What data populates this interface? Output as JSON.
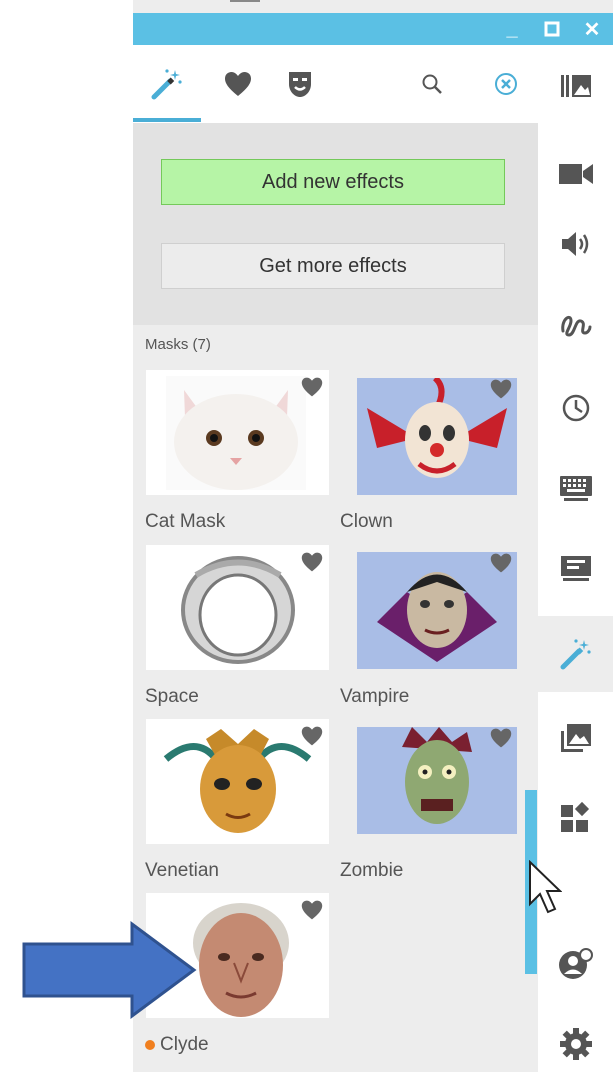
{
  "window": {
    "controls": [
      {
        "name": "minimize",
        "glyph": "_"
      },
      {
        "name": "maximize",
        "glyph": "☐"
      },
      {
        "name": "close",
        "glyph": "✕"
      }
    ]
  },
  "tabs": [
    {
      "name": "effects",
      "icon": "magic-wand-icon",
      "active": true
    },
    {
      "name": "favorites",
      "icon": "heart-icon"
    },
    {
      "name": "masks",
      "icon": "mask-icon"
    }
  ],
  "toolbar": {
    "search_icon": "search-icon",
    "clear_icon": "clear-circle-icon"
  },
  "actions": {
    "add_label": "Add new effects",
    "more_label": "Get more effects"
  },
  "section": {
    "label": "Masks (7)"
  },
  "masks": [
    {
      "name": "Cat Mask",
      "bg": "#ffffff"
    },
    {
      "name": "Clown",
      "bg": "#a9bde6"
    },
    {
      "name": "Space",
      "bg": "#ffffff"
    },
    {
      "name": "Vampire",
      "bg": "#a9bde6"
    },
    {
      "name": "Venetian",
      "bg": "#ffffff"
    },
    {
      "name": "Zombie",
      "bg": "#a9bde6"
    },
    {
      "name": "Clyde",
      "bg": "#ffffff",
      "status_dot": "#f07f1f"
    }
  ],
  "right_sidebar": [
    "gallery-icon",
    "video-camera-icon",
    "speaker-icon",
    "squiggle-icon",
    "clock-icon",
    "keyboard-icon",
    "presentation-icon",
    "magic-wand-icon",
    "images-icon",
    "apps-icon",
    "avatar-icon",
    "settings-gear-icon"
  ],
  "colors": {
    "accent": "#5bc0e4",
    "add_button": "#b6f4a6",
    "arrow": "#4472c4"
  }
}
